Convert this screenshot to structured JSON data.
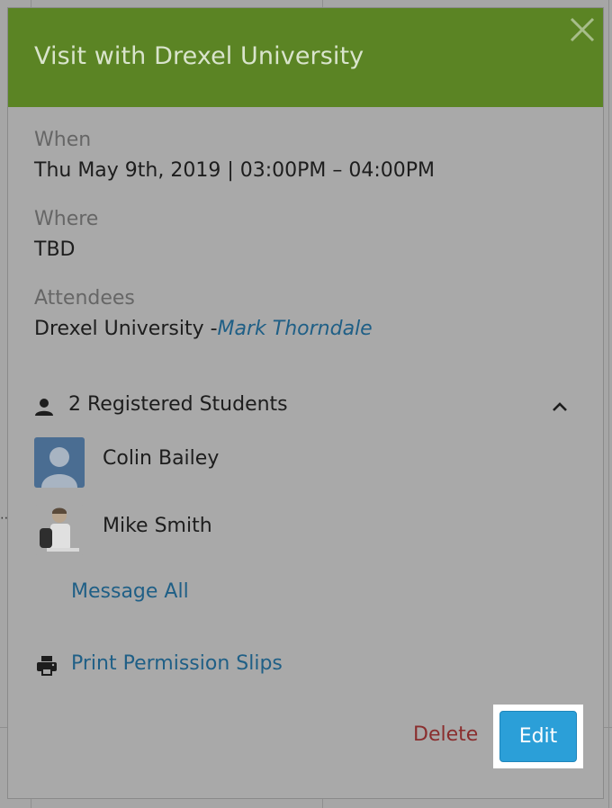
{
  "modal": {
    "title": "Visit with Drexel University",
    "when": {
      "label": "When",
      "value": "Thu May 9th, 2019 | 03:00PM – 04:00PM"
    },
    "where": {
      "label": "Where",
      "value": "TBD"
    },
    "attendees": {
      "label": "Attendees",
      "organization": "Drexel University -",
      "contact": "Mark Thorndale"
    },
    "students": {
      "header": "2 Registered Students",
      "list": [
        {
          "name": "Colin Bailey"
        },
        {
          "name": "Mike Smith"
        }
      ],
      "message_all": "Message All"
    },
    "print_label": "Print Permission Slips",
    "actions": {
      "delete_label": "Delete",
      "edit_label": "Edit"
    }
  },
  "colors": {
    "header_green": "#5b8424",
    "link_blue": "#1f5f86",
    "delete_red": "#8a2e2e",
    "edit_blue": "#2b9fd8"
  },
  "icons": [
    "close-icon",
    "person-icon",
    "chevron-up-icon",
    "print-icon"
  ]
}
